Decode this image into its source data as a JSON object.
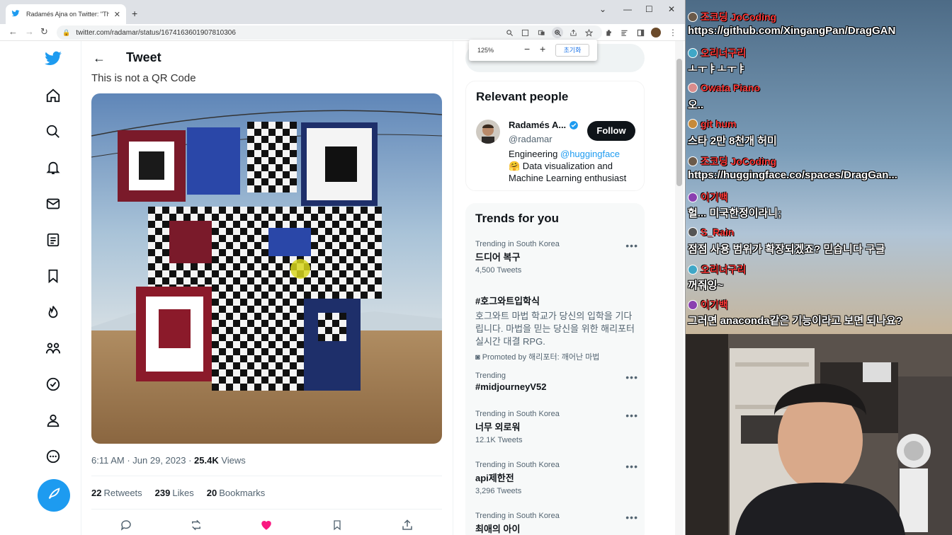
{
  "browser": {
    "tab_title": "Radamés Ajna on Twitter: \"This",
    "url": "twitter.com/radamar/status/1674163601907810306",
    "zoom": {
      "level": "125%",
      "reset_label": "초기화"
    }
  },
  "tweet": {
    "header": "Tweet",
    "text": "This is not a QR Code",
    "time": "6:11 AM · Jun 29, 2023 · ",
    "views": "25.4K",
    "views_label": " Views",
    "retweets": "22",
    "retweets_label": "Retweets",
    "likes": "239",
    "likes_label": "Likes",
    "bookmarks": "20",
    "bookmarks_label": "Bookmarks"
  },
  "relevant": {
    "title": "Relevant people",
    "name": "Radamés A...",
    "handle": "@radamar",
    "follow": "Follow",
    "bio_prefix": "Engineering ",
    "bio_link": "@huggingface",
    "bio_rest": "🤗 Data visualization and Machine Learning enthusiast"
  },
  "trends": {
    "title": "Trends for you",
    "items": [
      {
        "ctx": "Trending in South Korea",
        "name": "드디어 복구",
        "count": "4,500 Tweets"
      },
      {
        "ctx": "",
        "name": "#호그와트입학식",
        "desc": "호그와트 마법 학교가 당신의 입학을 기다립니다. 마법을 믿는 당신을 위한 해리포터 실시간 대결 RPG.",
        "promo": "Promoted by 해리포터: 깨어난 마법"
      },
      {
        "ctx": "Trending",
        "name": "#midjourneyV52",
        "count": ""
      },
      {
        "ctx": "Trending in South Korea",
        "name": "너무 외로워",
        "count": "12.1K Tweets"
      },
      {
        "ctx": "Trending in South Korea",
        "name": "api제한전",
        "count": "3,296 Tweets"
      },
      {
        "ctx": "Trending in South Korea",
        "name": "최애의 아이",
        "count": ""
      }
    ]
  },
  "chat": [
    {
      "user": "조코딩 JoCoding",
      "msg": "https://github.com/XingangPan/DragGAN"
    },
    {
      "user": "오리너구리",
      "msg": "ㅗㅜㅑㅗㅜㅑ"
    },
    {
      "user": "Owata Piano",
      "msg": "오.."
    },
    {
      "user": "git hum",
      "msg": "스타 2만 8천개 허미"
    },
    {
      "user": "조코딩 JoCoding",
      "msg": "https://huggingface.co/spaces/DragGan..."
    },
    {
      "user": "이기백",
      "msg": "헐... 미국한정이라니;"
    },
    {
      "user": "S_Rain",
      "msg": "점점 사용 범위가 확장되겠죠? 믿습니다 구글"
    },
    {
      "user": "오리너구리",
      "msg": "꺼줘잉~"
    },
    {
      "user": "이기백",
      "msg": "그러면 anaconda같은 기능이라고 보면 되나요?"
    }
  ],
  "colors": {
    "twitter_blue": "#1d9bf0",
    "like_pink": "#f91880",
    "text_dark": "#0f1419",
    "text_gray": "#536471"
  }
}
